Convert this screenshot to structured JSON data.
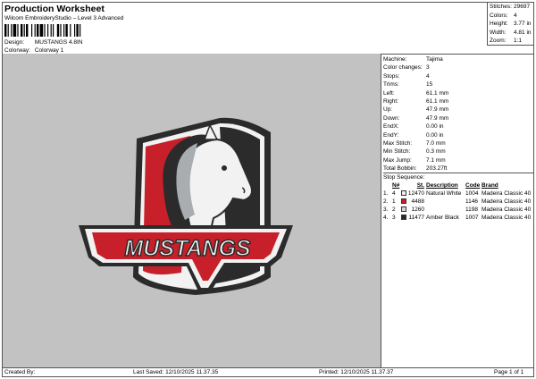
{
  "header": {
    "title": "Production Worksheet",
    "software": "Wilcom EmbroideryStudio – Level 3 Advanced",
    "design_label": "Design:",
    "design_value": "MUSTANGS 4.8IN",
    "colorway_label": "Colorway:",
    "colorway_value": "Colorway 1"
  },
  "stats": {
    "stitches_label": "Stitches:",
    "stitches": "29697",
    "colors_label": "Colors:",
    "colors": "4",
    "height_label": "Height:",
    "height": "3.77 in",
    "width_label": "Width:",
    "width": "4.81 in",
    "zoom_label": "Zoom:",
    "zoom": "1:1"
  },
  "machine": [
    {
      "k": "Machine:",
      "v": "Tajima"
    },
    {
      "k": "Color changes:",
      "v": "3"
    },
    {
      "k": "Stops:",
      "v": "4"
    },
    {
      "k": "Trims:",
      "v": "15"
    },
    {
      "k": "Left:",
      "v": "61.1 mm"
    },
    {
      "k": "Right:",
      "v": "61.1 mm"
    },
    {
      "k": "Up:",
      "v": "47.9 mm"
    },
    {
      "k": "Down:",
      "v": "47.9 mm"
    },
    {
      "k": "EndX:",
      "v": "0.00 in"
    },
    {
      "k": "EndY:",
      "v": "0.00 in"
    },
    {
      "k": "Max Stitch:",
      "v": "7.0 mm"
    },
    {
      "k": "Min Stitch:",
      "v": "0.3 mm"
    },
    {
      "k": "Max Jump:",
      "v": "7.1 mm"
    },
    {
      "k": "Total Bobbin:",
      "v": "203.27ft"
    }
  ],
  "sequence": {
    "title": "Stop Sequence:",
    "headers": {
      "n": "N#",
      "st": "St.",
      "desc": "Description",
      "code": "Code",
      "brand": "Brand"
    },
    "rows": [
      {
        "idx": "1.",
        "n": "4",
        "color": "#eeeeee",
        "st": "12470",
        "desc": "Natural White",
        "code": "1004",
        "brand": "Madeira Classic 40"
      },
      {
        "idx": "2.",
        "n": "1",
        "color": "#c8202a",
        "st": "4488",
        "desc": "",
        "code": "1146",
        "brand": "Madeira Classic 40"
      },
      {
        "idx": "3.",
        "n": "2",
        "color": "#d3d6d9",
        "st": "1260",
        "desc": "",
        "code": "1198",
        "brand": "Madeira Classic 40"
      },
      {
        "idx": "4.",
        "n": "3",
        "color": "#2a2a2a",
        "st": "11477",
        "desc": "Amber Black",
        "code": "1007",
        "brand": "Madeira Classic 40"
      }
    ]
  },
  "design_art": {
    "text": "MUSTANGS",
    "colors": {
      "red": "#c8202a",
      "black": "#2b2b2b",
      "white": "#f2f2f2",
      "grey": "#a9adb0"
    }
  },
  "footer": {
    "created": "Created By:",
    "last_saved": "Last Saved: 12/10/2025 11.37.35",
    "printed": "Printed: 12/10/2025 11.37.37",
    "page": "Page 1 of 1"
  }
}
